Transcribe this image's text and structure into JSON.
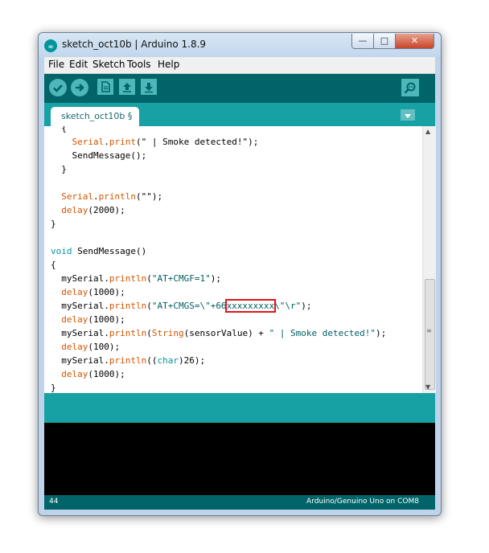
{
  "window": {
    "title": "sketch_oct10b | Arduino 1.8.9",
    "minimize_glyph": "—",
    "maximize_glyph": "□",
    "close_glyph": "✕"
  },
  "menu": [
    "File",
    "Edit",
    "Sketch",
    "Tools",
    "Help"
  ],
  "toolbar": {
    "verify_icon": "check-icon",
    "upload_icon": "arrow-right-icon",
    "new_icon": "file-icon",
    "open_icon": "arrow-up-icon",
    "save_icon": "arrow-down-icon",
    "serial_monitor_icon": "magnifier-icon"
  },
  "tab": {
    "label": "sketch_oct10b §"
  },
  "code_lines": [
    [
      {
        "t": "  {",
        "c": ""
      }
    ],
    [
      {
        "t": "    ",
        "c": ""
      },
      {
        "t": "Serial",
        "c": "kw-o"
      },
      {
        "t": ".",
        "c": ""
      },
      {
        "t": "print",
        "c": "kw-o"
      },
      {
        "t": "(\" | Smoke detected!\");",
        "c": ""
      }
    ],
    [
      {
        "t": "    SendMessage();",
        "c": ""
      }
    ],
    [
      {
        "t": "  }",
        "c": ""
      }
    ],
    [
      {
        "t": "",
        "c": ""
      }
    ],
    [
      {
        "t": "  ",
        "c": ""
      },
      {
        "t": "Serial",
        "c": "kw-o"
      },
      {
        "t": ".",
        "c": ""
      },
      {
        "t": "println",
        "c": "kw-o"
      },
      {
        "t": "(\"\");",
        "c": ""
      }
    ],
    [
      {
        "t": "  ",
        "c": ""
      },
      {
        "t": "delay",
        "c": "kw-o"
      },
      {
        "t": "(2000);",
        "c": ""
      }
    ],
    [
      {
        "t": "}",
        "c": ""
      }
    ],
    [
      {
        "t": "",
        "c": ""
      }
    ],
    [
      {
        "t": "void",
        "c": "kw-b"
      },
      {
        "t": " SendMessage()",
        "c": ""
      }
    ],
    [
      {
        "t": "{",
        "c": ""
      }
    ],
    [
      {
        "t": "  mySerial.",
        "c": ""
      },
      {
        "t": "println",
        "c": "kw-o"
      },
      {
        "t": "(",
        "c": ""
      },
      {
        "t": "\"AT+CMGF=1\"",
        "c": "str"
      },
      {
        "t": ");",
        "c": ""
      }
    ],
    [
      {
        "t": "  ",
        "c": ""
      },
      {
        "t": "delay",
        "c": "kw-o"
      },
      {
        "t": "(1000);",
        "c": ""
      }
    ],
    [
      {
        "t": "  mySerial.",
        "c": ""
      },
      {
        "t": "println",
        "c": "kw-o"
      },
      {
        "t": "(",
        "c": ""
      },
      {
        "t": "\"AT+CMGS=\\\"+66",
        "c": "str"
      },
      {
        "t": "xxxxxxxxx",
        "c": "redact"
      },
      {
        "t": "\\\"\\r\"",
        "c": "str"
      },
      {
        "t": ");",
        "c": ""
      }
    ],
    [
      {
        "t": "  ",
        "c": ""
      },
      {
        "t": "delay",
        "c": "kw-o"
      },
      {
        "t": "(1000);",
        "c": ""
      }
    ],
    [
      {
        "t": "  mySerial.",
        "c": ""
      },
      {
        "t": "println",
        "c": "kw-o"
      },
      {
        "t": "(",
        "c": ""
      },
      {
        "t": "String",
        "c": "kw-o"
      },
      {
        "t": "(sensorValue) + ",
        "c": ""
      },
      {
        "t": "\" | Smoke detected!\"",
        "c": "str"
      },
      {
        "t": ");",
        "c": ""
      }
    ],
    [
      {
        "t": "  ",
        "c": ""
      },
      {
        "t": "delay",
        "c": "kw-o"
      },
      {
        "t": "(100);",
        "c": ""
      }
    ],
    [
      {
        "t": "  mySerial.",
        "c": ""
      },
      {
        "t": "println",
        "c": "kw-o"
      },
      {
        "t": "((",
        "c": ""
      },
      {
        "t": "char",
        "c": "kw-b"
      },
      {
        "t": ")26);",
        "c": ""
      }
    ],
    [
      {
        "t": "  ",
        "c": ""
      },
      {
        "t": "delay",
        "c": "kw-o"
      },
      {
        "t": "(1000);",
        "c": ""
      }
    ],
    [
      {
        "t": "}",
        "c": ""
      }
    ]
  ],
  "footer": {
    "line_number": "44",
    "board": "Arduino/Genuino Uno on COM8"
  }
}
